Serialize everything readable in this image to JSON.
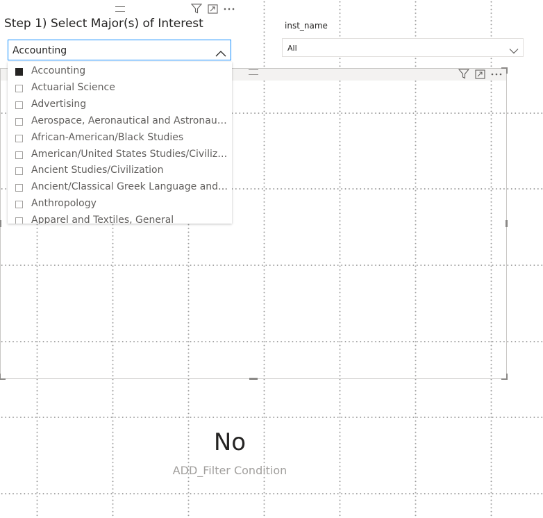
{
  "slicer_major": {
    "title": "Step 1) Select Major(s) of Interest",
    "selected_value": "Accounting",
    "options": [
      {
        "label": "Accounting",
        "checked": true
      },
      {
        "label": "Actuarial Science",
        "checked": false
      },
      {
        "label": "Advertising",
        "checked": false
      },
      {
        "label": "Aerospace, Aeronautical and Astronautic...",
        "checked": false
      },
      {
        "label": "African-American/Black Studies",
        "checked": false
      },
      {
        "label": "American/United States Studies/Civilization",
        "checked": false
      },
      {
        "label": "Ancient Studies/Civilization",
        "checked": false
      },
      {
        "label": "Ancient/Classical Greek Language and Lit...",
        "checked": false
      },
      {
        "label": "Anthropology",
        "checked": false
      },
      {
        "label": "Apparel and Textiles, General",
        "checked": false
      }
    ]
  },
  "slicer_inst": {
    "title": "inst_name",
    "selected_value": "All"
  },
  "card": {
    "value": "No",
    "label": "ADD_Filter Condition"
  },
  "colors": {
    "accent": "#118dff",
    "text": "#252423",
    "muted": "#605e5c",
    "faint": "#a19f9d"
  },
  "icons": [
    "filter-icon",
    "focus-mode-icon",
    "more-options-icon",
    "chevron-up-icon",
    "chevron-down-icon",
    "drag-grip-icon"
  ]
}
